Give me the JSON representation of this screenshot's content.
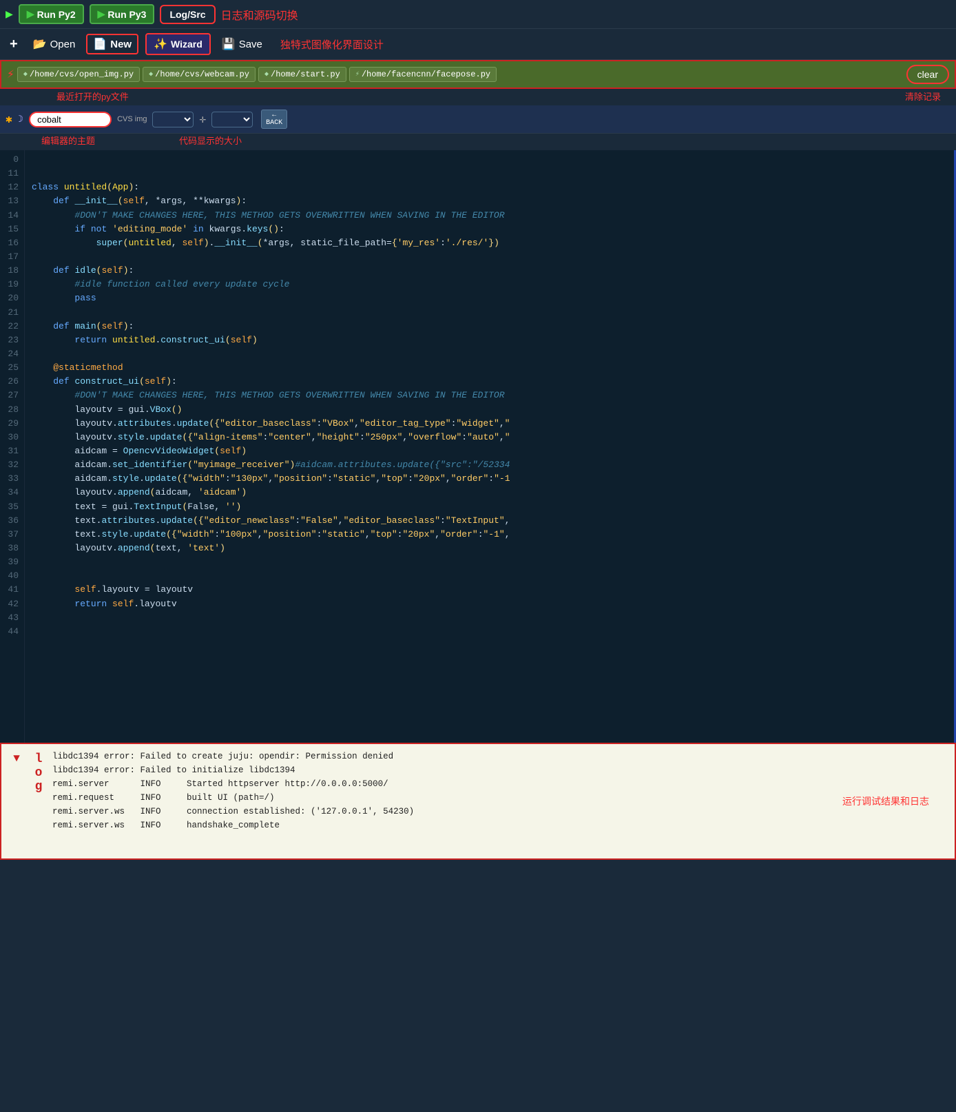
{
  "toolbar1": {
    "run_py2_label": "Run Py2",
    "run_py3_label": "Run Py3",
    "log_src_label": "Log/Src",
    "log_src_annotation": "日志和源码切换"
  },
  "toolbar2": {
    "add_icon": "+",
    "open_label": "Open",
    "new_label": "New",
    "wizard_label": "Wizard",
    "save_label": "Save",
    "annotation": "独特式图像化界面设计"
  },
  "filetabs": {
    "tabs": [
      {
        "label": "/home/cvs/open_img.py"
      },
      {
        "label": "/home/cvs/webcam.py"
      },
      {
        "label": "/home/start.py"
      },
      {
        "label": "/home/facencnn/facepose.py"
      }
    ],
    "clear_label": "clear",
    "tabs_annotation": "最近打开的py文件",
    "clear_annotation": "清除记录"
  },
  "themebar": {
    "theme_value": "cobalt",
    "theme_annotation": "编辑器的主题",
    "size_annotation": "代码显示的大小",
    "back_label": "BACK"
  },
  "code": {
    "lines": [
      "",
      "0",
      "11",
      "12",
      "13",
      "14",
      "15",
      "16",
      "17",
      "18",
      "19",
      "20",
      "21",
      "22",
      "23",
      "24",
      "25",
      "26",
      "27",
      "28",
      "29",
      "30",
      "31",
      "32",
      "33",
      "34",
      "35",
      "36",
      "37",
      "38",
      "39",
      "40",
      "41",
      "42",
      "43",
      "44"
    ]
  },
  "log": {
    "entries": [
      "libdc1394 error: Failed to create juju: opendir: Permission denied",
      "libdc1394 error: Failed to initialize libdc1394",
      "remi.server      INFO     Started httpserver http://0.0.0.0:5000/",
      "remi.request     INFO     built UI (path=/)",
      "remi.server.ws   INFO     connection established: ('127.0.0.1', 54230)",
      "remi.server.ws   INFO     handshake_complete"
    ],
    "sidebar_label": "l\no\ng",
    "annotation": "运行调试结果和日志"
  }
}
